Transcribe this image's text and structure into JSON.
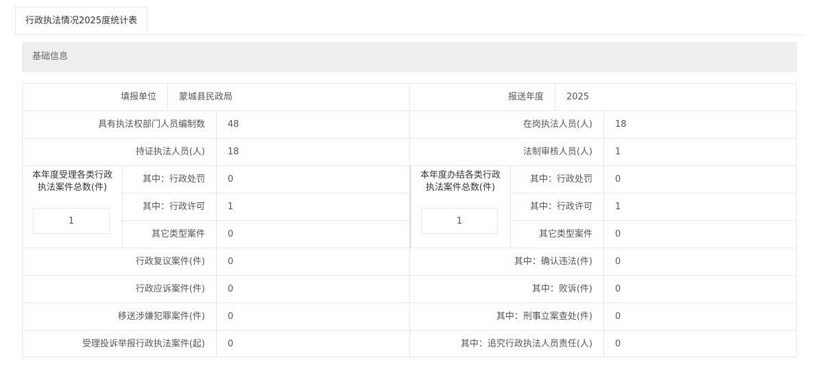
{
  "tab": {
    "label": "行政执法情况2025度统计表"
  },
  "section": {
    "title": "基础信息"
  },
  "row1": {
    "unit_label": "填报单位",
    "unit_value": "蒙城县民政局",
    "year_label": "报送年度",
    "year_value": "2025"
  },
  "row2": {
    "staff_quota_label": "具有执法权部门人员编制数",
    "staff_quota_value": "48",
    "on_duty_label": "在岗执法人员(人)",
    "on_duty_value": "18"
  },
  "row3": {
    "certified_label": "持证执法人员(人)",
    "certified_value": "18",
    "legal_review_label": "法制审核人员(人)",
    "legal_review_value": "1"
  },
  "accepted": {
    "title": "本年度受理各类行政执法案件总数(件)",
    "total": "1",
    "rows": [
      {
        "label": "其中：行政处罚",
        "value": "0"
      },
      {
        "label": "其中：行政许可",
        "value": "1"
      },
      {
        "label": "其它类型案件",
        "value": "0"
      }
    ]
  },
  "concluded": {
    "title": "本年度办结各类行政执法案件总数(件)",
    "total": "1",
    "rows": [
      {
        "label": "其中：行政处罚",
        "value": "0"
      },
      {
        "label": "其中：行政许可",
        "value": "1"
      },
      {
        "label": "其它类型案件",
        "value": "0"
      }
    ]
  },
  "lower": [
    {
      "left_label": "行政复议案件(件)",
      "left_value": "0",
      "right_label": "其中：确认违法(件)",
      "right_value": "0"
    },
    {
      "left_label": "行政应诉案件(件)",
      "left_value": "0",
      "right_label": "其中：败诉(件)",
      "right_value": "0"
    },
    {
      "left_label": "移送涉嫌犯罪案件(件)",
      "left_value": "0",
      "right_label": "其中：刑事立案查处(件)",
      "right_value": "0"
    },
    {
      "left_label": "受理投诉举报行政执法案件(起)",
      "left_value": "0",
      "right_label": "其中：追究行政执法人员责任(人)",
      "right_value": "0"
    }
  ]
}
